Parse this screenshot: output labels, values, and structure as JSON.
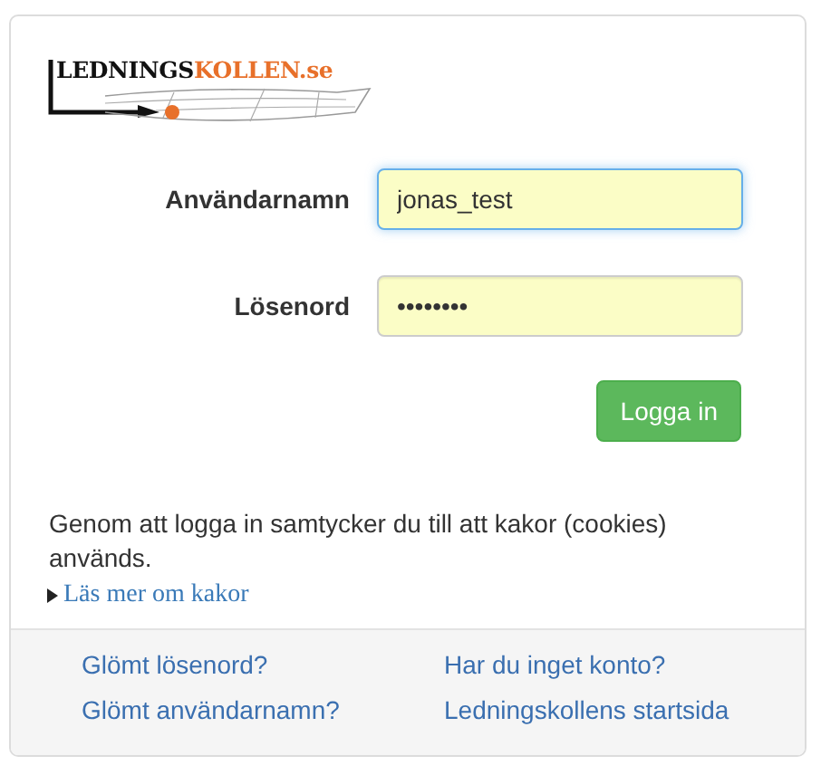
{
  "logo": {
    "dark": "LEDNINGS",
    "accent": "KOLLEN.se"
  },
  "fields": [
    {
      "label": "Användarnamn",
      "value": "jonas_test",
      "focused": true
    },
    {
      "label": "Lösenord",
      "value": "••••••••",
      "focused": false
    }
  ],
  "submit": "Logga in",
  "consent": "Genom att logga in samtycker du till att kakor (cookies) används.",
  "more": {
    "label": "Läs mer om kakor",
    "expanded": false
  },
  "footer_links": [
    [
      "Glömt lösenord?",
      "Glömt användarnamn?"
    ],
    [
      "Har du inget konto?",
      "Ledningskollens startsida"
    ]
  ]
}
